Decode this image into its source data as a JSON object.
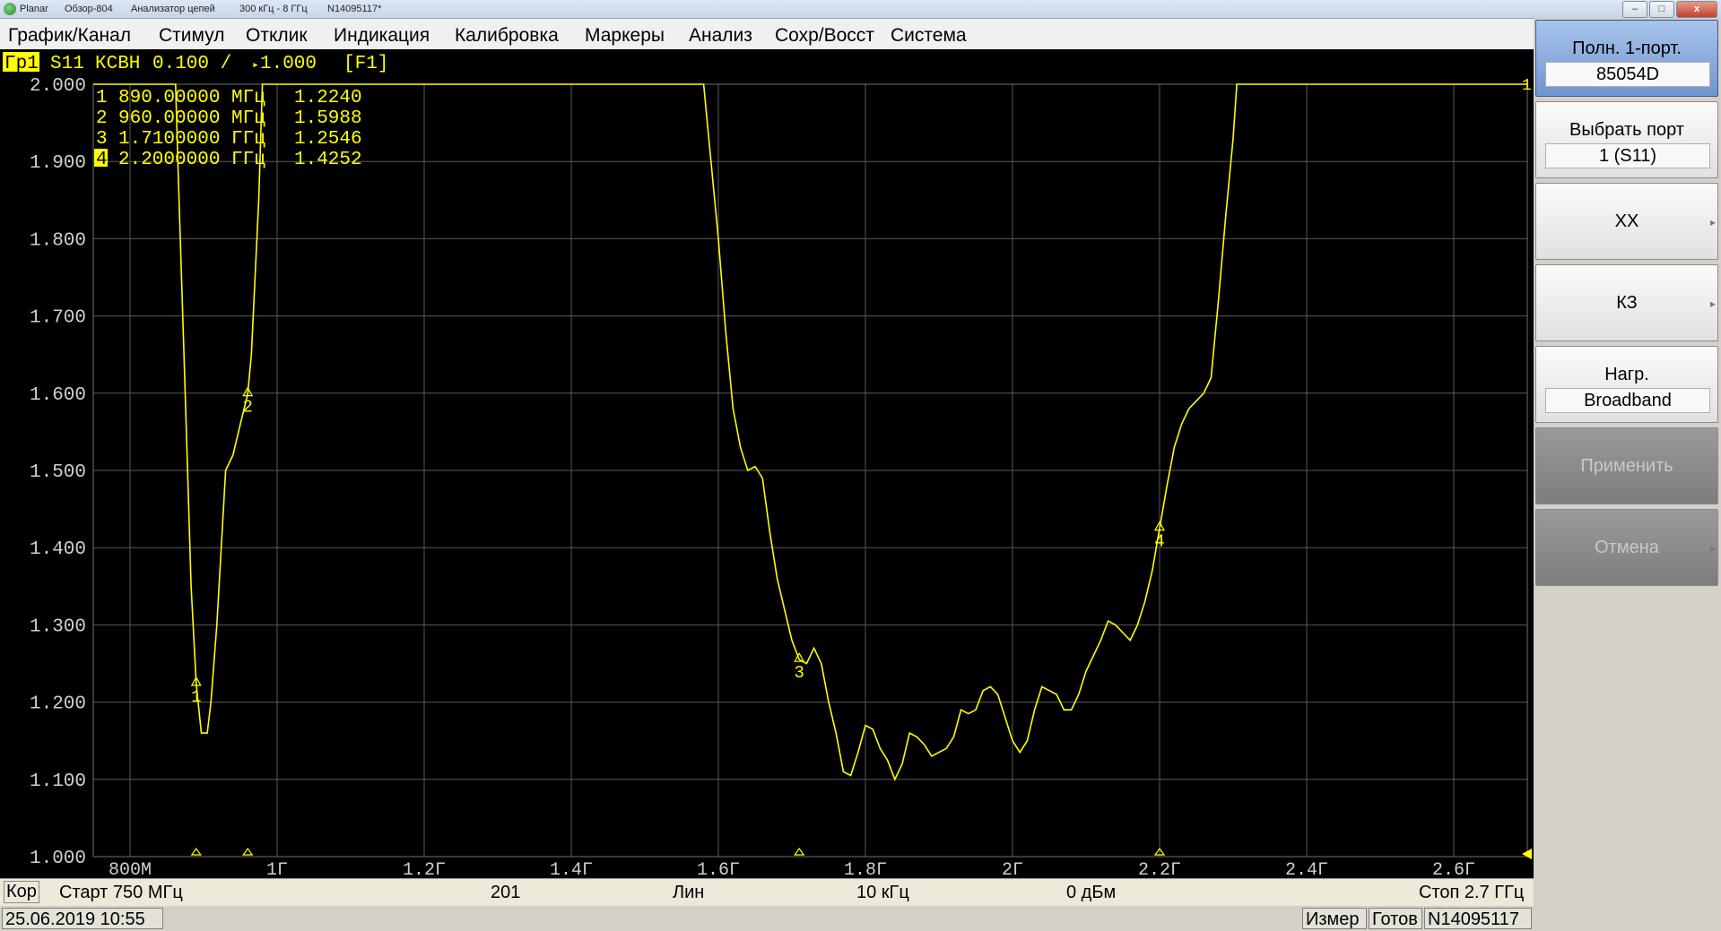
{
  "titlebar": {
    "app": "Planar",
    "model": "Обзор-804",
    "type": "Анализатор цепей",
    "range": "300 кГц - 8 ГГц",
    "serial": "N14095117*"
  },
  "window_buttons": {
    "minimize": "–",
    "maximize": "□",
    "close": "x"
  },
  "menu": [
    "График/Канал",
    "Стимул",
    "Отклик",
    "Индикация",
    "Калибровка",
    "Маркеры",
    "Анализ",
    "Сохр/Восст",
    "Система"
  ],
  "trace_header": {
    "graph": "Гр1",
    "param": "S11",
    "format": "КСВН",
    "scale": "0.100 /",
    "ref": "1.000",
    "fkey": "[F1]"
  },
  "markers": [
    {
      "n": "1",
      "freq": "890.00000 МГц",
      "value": "1.2240"
    },
    {
      "n": "2",
      "freq": "960.00000 МГц",
      "value": "1.5988"
    },
    {
      "n": "3",
      "freq": "1.7100000 ГГц",
      "value": "1.2546"
    },
    {
      "n": "4",
      "freq": "2.2000000 ГГц",
      "value": "1.4252"
    }
  ],
  "trace_label": "1",
  "chart_data": {
    "type": "line",
    "x_unit": "GHz",
    "xlim": [
      0.75,
      2.7
    ],
    "ylim": [
      1.0,
      2.0
    ],
    "y_ticks": [
      "2.000",
      "1.900",
      "1.800",
      "1.700",
      "1.600",
      "1.500",
      "1.400",
      "1.300",
      "1.200",
      "1.100",
      "1.000"
    ],
    "x_ticks": [
      {
        "x": 0.8,
        "label": "800M"
      },
      {
        "x": 1.0,
        "label": "1Г"
      },
      {
        "x": 1.2,
        "label": "1.2Г"
      },
      {
        "x": 1.4,
        "label": "1.4Г"
      },
      {
        "x": 1.6,
        "label": "1.6Г"
      },
      {
        "x": 1.8,
        "label": "1.8Г"
      },
      {
        "x": 2.0,
        "label": "2Г"
      },
      {
        "x": 2.2,
        "label": "2.2Г"
      },
      {
        "x": 2.4,
        "label": "2.4Г"
      },
      {
        "x": 2.6,
        "label": "2.6Г"
      }
    ],
    "series": [
      {
        "color": "#ffff00",
        "points": [
          [
            0.75,
            2.0
          ],
          [
            0.862,
            2.0
          ],
          [
            0.865,
            1.9
          ],
          [
            0.875,
            1.6
          ],
          [
            0.883,
            1.35
          ],
          [
            0.89,
            1.224
          ],
          [
            0.897,
            1.16
          ],
          [
            0.905,
            1.16
          ],
          [
            0.91,
            1.2
          ],
          [
            0.918,
            1.3
          ],
          [
            0.924,
            1.4
          ],
          [
            0.93,
            1.5
          ],
          [
            0.94,
            1.52
          ],
          [
            0.95,
            1.56
          ],
          [
            0.96,
            1.599
          ],
          [
            0.965,
            1.65
          ],
          [
            0.97,
            1.75
          ],
          [
            0.975,
            1.85
          ],
          [
            0.98,
            2.0
          ],
          [
            1.58,
            2.0
          ],
          [
            1.59,
            1.9
          ],
          [
            1.6,
            1.8
          ],
          [
            1.61,
            1.68
          ],
          [
            1.62,
            1.58
          ],
          [
            1.63,
            1.53
          ],
          [
            1.64,
            1.5
          ],
          [
            1.65,
            1.505
          ],
          [
            1.66,
            1.49
          ],
          [
            1.67,
            1.42
          ],
          [
            1.68,
            1.36
          ],
          [
            1.69,
            1.32
          ],
          [
            1.7,
            1.28
          ],
          [
            1.71,
            1.255
          ],
          [
            1.72,
            1.25
          ],
          [
            1.73,
            1.27
          ],
          [
            1.74,
            1.25
          ],
          [
            1.75,
            1.2
          ],
          [
            1.76,
            1.16
          ],
          [
            1.77,
            1.11
          ],
          [
            1.78,
            1.105
          ],
          [
            1.79,
            1.135
          ],
          [
            1.8,
            1.17
          ],
          [
            1.81,
            1.165
          ],
          [
            1.82,
            1.14
          ],
          [
            1.83,
            1.125
          ],
          [
            1.84,
            1.1
          ],
          [
            1.85,
            1.12
          ],
          [
            1.86,
            1.16
          ],
          [
            1.87,
            1.155
          ],
          [
            1.88,
            1.145
          ],
          [
            1.89,
            1.13
          ],
          [
            1.9,
            1.135
          ],
          [
            1.91,
            1.14
          ],
          [
            1.92,
            1.155
          ],
          [
            1.93,
            1.19
          ],
          [
            1.94,
            1.185
          ],
          [
            1.95,
            1.19
          ],
          [
            1.96,
            1.215
          ],
          [
            1.97,
            1.22
          ],
          [
            1.98,
            1.21
          ],
          [
            1.99,
            1.18
          ],
          [
            2.0,
            1.15
          ],
          [
            2.01,
            1.135
          ],
          [
            2.02,
            1.15
          ],
          [
            2.03,
            1.19
          ],
          [
            2.04,
            1.22
          ],
          [
            2.05,
            1.215
          ],
          [
            2.06,
            1.21
          ],
          [
            2.07,
            1.19
          ],
          [
            2.08,
            1.19
          ],
          [
            2.09,
            1.21
          ],
          [
            2.1,
            1.24
          ],
          [
            2.11,
            1.26
          ],
          [
            2.12,
            1.28
          ],
          [
            2.13,
            1.305
          ],
          [
            2.14,
            1.3
          ],
          [
            2.15,
            1.29
          ],
          [
            2.16,
            1.28
          ],
          [
            2.17,
            1.3
          ],
          [
            2.18,
            1.33
          ],
          [
            2.19,
            1.37
          ],
          [
            2.2,
            1.425
          ],
          [
            2.21,
            1.48
          ],
          [
            2.22,
            1.53
          ],
          [
            2.23,
            1.56
          ],
          [
            2.24,
            1.58
          ],
          [
            2.25,
            1.59
          ],
          [
            2.26,
            1.6
          ],
          [
            2.27,
            1.62
          ],
          [
            2.28,
            1.72
          ],
          [
            2.29,
            1.83
          ],
          [
            2.3,
            1.93
          ],
          [
            2.305,
            2.0
          ],
          [
            2.7,
            2.0
          ]
        ]
      }
    ],
    "marker_points": [
      {
        "n": "1",
        "x": 0.89,
        "y": 1.224
      },
      {
        "n": "2",
        "x": 0.96,
        "y": 1.599
      },
      {
        "n": "3",
        "x": 1.71,
        "y": 1.255
      },
      {
        "n": "4",
        "x": 2.2,
        "y": 1.425
      }
    ]
  },
  "status_bar": {
    "cor": "Кор",
    "start": "Старт 750 МГц",
    "points": "201",
    "sweep": "Лин",
    "ifbw": "10 кГц",
    "power": "0 дБм",
    "stop": "Стоп 2.7 ГГц"
  },
  "bottom_bar": {
    "datetime": "25.06.2019 10:55",
    "measure": "Измер",
    "ready": "Готов",
    "serial": "N14095117"
  },
  "softkeys": [
    {
      "label": "Полн. 1-порт.",
      "value": "85054D",
      "state": "active"
    },
    {
      "label": "Выбрать порт",
      "value": "1 (S11)",
      "state": "normal"
    },
    {
      "label": "ХХ",
      "state": "normal"
    },
    {
      "label": "КЗ",
      "state": "normal"
    },
    {
      "label": "Нагр.",
      "value": "Broadband",
      "state": "normal"
    },
    {
      "label": "Применить",
      "state": "disabled"
    },
    {
      "label": "Отмена",
      "state": "disabled"
    }
  ]
}
